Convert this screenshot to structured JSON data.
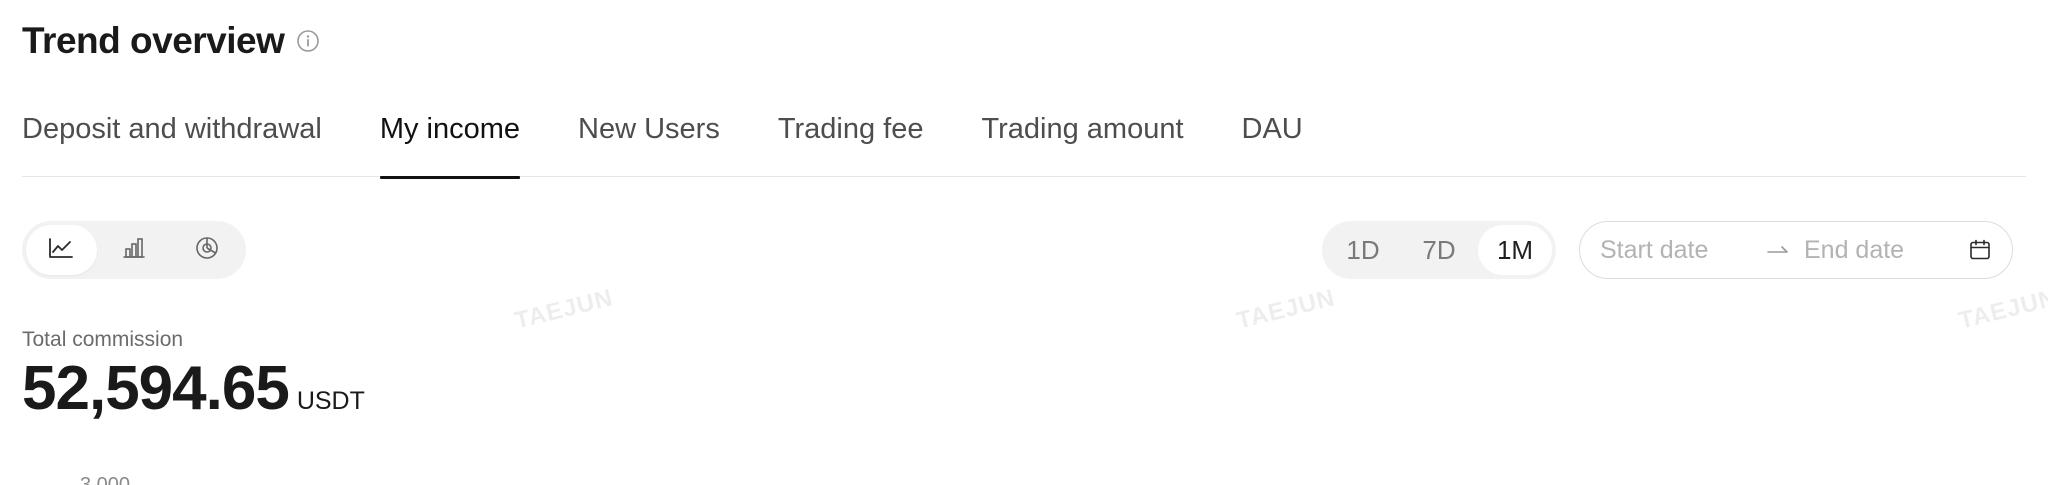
{
  "header": {
    "title": "Trend overview",
    "info_icon": "info-circle-icon"
  },
  "tabs": [
    {
      "label": "Deposit and withdrawal",
      "active": false
    },
    {
      "label": "My income",
      "active": true
    },
    {
      "label": "New Users",
      "active": false
    },
    {
      "label": "Trading fee",
      "active": false
    },
    {
      "label": "Trading amount",
      "active": false
    },
    {
      "label": "DAU",
      "active": false
    }
  ],
  "chart_switch": {
    "options": [
      {
        "icon": "line-chart-icon",
        "active": true
      },
      {
        "icon": "bar-chart-icon",
        "active": false
      },
      {
        "icon": "pie-chart-icon",
        "active": false
      }
    ]
  },
  "range": {
    "options": [
      {
        "label": "1D",
        "active": false
      },
      {
        "label": "7D",
        "active": false
      },
      {
        "label": "1M",
        "active": true
      }
    ]
  },
  "date_range": {
    "start_placeholder": "Start date",
    "end_placeholder": "End date",
    "arrow_icon": "arrow-right-icon",
    "calendar_icon": "calendar-icon"
  },
  "watermark": "TAEJUN",
  "stats": {
    "label": "Total commission",
    "value": "52,594.65",
    "unit": "USDT"
  },
  "chart_axis": {
    "top_tick": "3,000"
  },
  "colors": {
    "text_primary": "#1a1a1a",
    "text_secondary": "#6b6b6b",
    "segment_bg": "#f2f2f2",
    "divider": "#e6e6e6"
  }
}
